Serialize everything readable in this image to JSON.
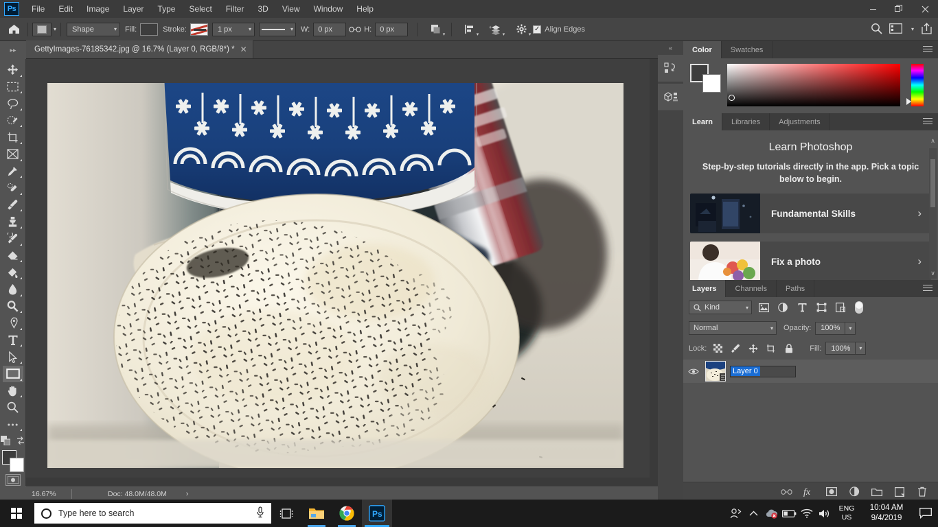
{
  "menubar": {
    "logo": "Ps",
    "items": [
      "File",
      "Edit",
      "Image",
      "Layer",
      "Type",
      "Select",
      "Filter",
      "3D",
      "View",
      "Window",
      "Help"
    ],
    "window_controls": {
      "minimize": "–",
      "maximize": "❐",
      "close": "✕"
    }
  },
  "options_bar": {
    "home_icon": "home-icon",
    "tool_preset_icon": "rectangle-preset-icon",
    "mode_value": "Shape",
    "fill_label": "Fill:",
    "fill_color": "#3d3d3d",
    "stroke_label": "Stroke:",
    "stroke_width": "1 px",
    "width_label": "W:",
    "width_value": "0 px",
    "link_icon": "link-icon",
    "height_label": "H:",
    "height_value": "0 px",
    "path_ops_icon": "path-operations-icon",
    "path_align_icon": "path-alignment-icon",
    "path_arrange_icon": "path-arrangement-icon",
    "gear_icon": "gear-icon",
    "align_edges_label": "Align Edges",
    "align_edges_checked": true,
    "search_icon": "search-icon",
    "workspace_icon": "workspace-switcher-icon",
    "share_icon": "share-icon"
  },
  "document": {
    "tab_title": "GettyImages-76185342.jpg @ 16.7% (Layer 0, RGB/8*) *",
    "close_glyph": "✕"
  },
  "toolbar": {
    "tools": [
      {
        "name": "move-tool",
        "label": "Move Tool",
        "active": false
      },
      {
        "name": "rectangular-marquee-tool",
        "label": "Rectangular Marquee Tool",
        "active": false
      },
      {
        "name": "lasso-tool",
        "label": "Lasso Tool",
        "active": false
      },
      {
        "name": "quick-selection-tool",
        "label": "Quick Selection Tool",
        "active": false
      },
      {
        "name": "crop-tool",
        "label": "Crop Tool",
        "active": false
      },
      {
        "name": "frame-tool",
        "label": "Frame Tool",
        "active": false
      },
      {
        "name": "eyedropper-tool",
        "label": "Eyedropper Tool",
        "active": false
      },
      {
        "name": "spot-healing-brush-tool",
        "label": "Spot Healing Brush Tool",
        "active": false
      },
      {
        "name": "brush-tool",
        "label": "Brush Tool",
        "active": false
      },
      {
        "name": "clone-stamp-tool",
        "label": "Clone Stamp Tool",
        "active": false
      },
      {
        "name": "history-brush-tool",
        "label": "History Brush Tool",
        "active": false
      },
      {
        "name": "eraser-tool",
        "label": "Eraser Tool",
        "active": false
      },
      {
        "name": "gradient-tool",
        "label": "Gradient Tool",
        "active": false
      },
      {
        "name": "blur-tool",
        "label": "Blur Tool",
        "active": false
      },
      {
        "name": "dodge-tool",
        "label": "Dodge Tool",
        "active": false
      },
      {
        "name": "pen-tool",
        "label": "Pen Tool",
        "active": false
      },
      {
        "name": "horizontal-type-tool",
        "label": "Horizontal Type Tool",
        "active": false
      },
      {
        "name": "path-selection-tool",
        "label": "Path Selection Tool",
        "active": false
      },
      {
        "name": "rectangle-tool",
        "label": "Rectangle Tool",
        "active": true
      },
      {
        "name": "hand-tool",
        "label": "Hand Tool",
        "active": false
      },
      {
        "name": "zoom-tool",
        "label": "Zoom Tool",
        "active": false
      },
      {
        "name": "edit-toolbar-tool",
        "label": "Edit Toolbar",
        "active": false
      }
    ],
    "swap_colors_icon": "swap-colors-icon",
    "default_colors_icon": "default-colors-icon",
    "foreground_color": "#3d3d3d",
    "background_color": "#ffffff",
    "quick_mask_icon": "quick-mask-icon"
  },
  "status_bar": {
    "zoom": "16.67%",
    "doc_info": "Doc: 48.0M/48.0M",
    "expand_glyph": "›"
  },
  "dock_rail": {
    "collapse_glyph": "«",
    "buttons": [
      {
        "name": "history-panel-icon",
        "label": "History"
      },
      {
        "name": "3d-panel-icon",
        "label": "3D"
      }
    ]
  },
  "color_panel": {
    "tabs": [
      {
        "label": "Color",
        "active": true
      },
      {
        "label": "Swatches",
        "active": false
      }
    ],
    "foreground_color": "#3d3d3d",
    "background_color": "#ffffff",
    "hue": "red",
    "menu_icon": "panel-menu-icon"
  },
  "learn_panel": {
    "tabs": [
      {
        "label": "Learn",
        "active": true
      },
      {
        "label": "Libraries",
        "active": false
      },
      {
        "label": "Adjustments",
        "active": false
      }
    ],
    "title": "Learn Photoshop",
    "subtitle": "Step-by-step tutorials directly in the app. Pick a topic below to begin.",
    "cards": [
      {
        "label": "Fundamental Skills",
        "chevron": "›"
      },
      {
        "label": "Fix a photo",
        "chevron": "›"
      }
    ],
    "menu_icon": "panel-menu-icon",
    "scroll_up_glyph": "∧",
    "scroll_down_glyph": "∨"
  },
  "layers_panel": {
    "tabs": [
      {
        "label": "Layers",
        "active": true
      },
      {
        "label": "Channels",
        "active": false
      },
      {
        "label": "Paths",
        "active": false
      }
    ],
    "filter_label": "Kind",
    "filter_icons": [
      "pixel-filter-icon",
      "adjustment-filter-icon",
      "type-filter-icon",
      "shape-filter-icon",
      "smart-object-filter-icon"
    ],
    "filter_toggle": "filter-enable-toggle",
    "blend_mode": "Normal",
    "opacity_label": "Opacity:",
    "opacity_value": "100%",
    "lock_label": "Lock:",
    "lock_icons": [
      "lock-transparent-pixels-icon",
      "lock-image-pixels-icon",
      "lock-position-icon",
      "lock-artboard-icon",
      "lock-all-icon"
    ],
    "fill_label": "Fill:",
    "fill_value": "100%",
    "layers": [
      {
        "name": "Layer 0",
        "visible": true,
        "editing": true
      }
    ],
    "footer_icons": [
      {
        "name": "link-layers-icon",
        "label": "Link layers"
      },
      {
        "name": "layer-style-icon",
        "label": "fx"
      },
      {
        "name": "layer-mask-icon",
        "label": "Add layer mask"
      },
      {
        "name": "adjustment-layer-icon",
        "label": "New adjustment layer"
      },
      {
        "name": "new-group-icon",
        "label": "New group"
      },
      {
        "name": "new-layer-icon",
        "label": "New layer"
      },
      {
        "name": "delete-layer-icon",
        "label": "Delete layer"
      }
    ],
    "menu_icon": "panel-menu-icon"
  },
  "taskbar": {
    "start_label": "Start",
    "search_placeholder": "Type here to search",
    "mic_icon": "microphone-icon",
    "task_view_icon": "task-view-icon",
    "apps": [
      {
        "name": "file-explorer-icon",
        "label": "File Explorer",
        "state": "open"
      },
      {
        "name": "chrome-icon",
        "label": "Google Chrome",
        "state": "open"
      },
      {
        "name": "photoshop-icon",
        "label": "Adobe Photoshop",
        "state": "active"
      }
    ],
    "tray": {
      "people_icon": "people-icon",
      "show_hidden_icon": "show-hidden-icons-chevron",
      "onedrive_icon": "onedrive-error-icon",
      "battery_icon": "battery-icon",
      "network_icon": "wifi-icon",
      "volume_icon": "volume-icon",
      "language_line1": "ENG",
      "language_line2": "US",
      "time": "10:04 AM",
      "date": "9/4/2019",
      "action_center_icon": "action-center-icon"
    }
  },
  "colors": {
    "accent_blue": "#31a8ff",
    "selection_blue": "#1a6dd4",
    "panel_bg": "#535353",
    "dock_bg": "#454545",
    "menubar_bg": "#3b3b3b",
    "taskbar_bg": "#1b1b1b"
  }
}
